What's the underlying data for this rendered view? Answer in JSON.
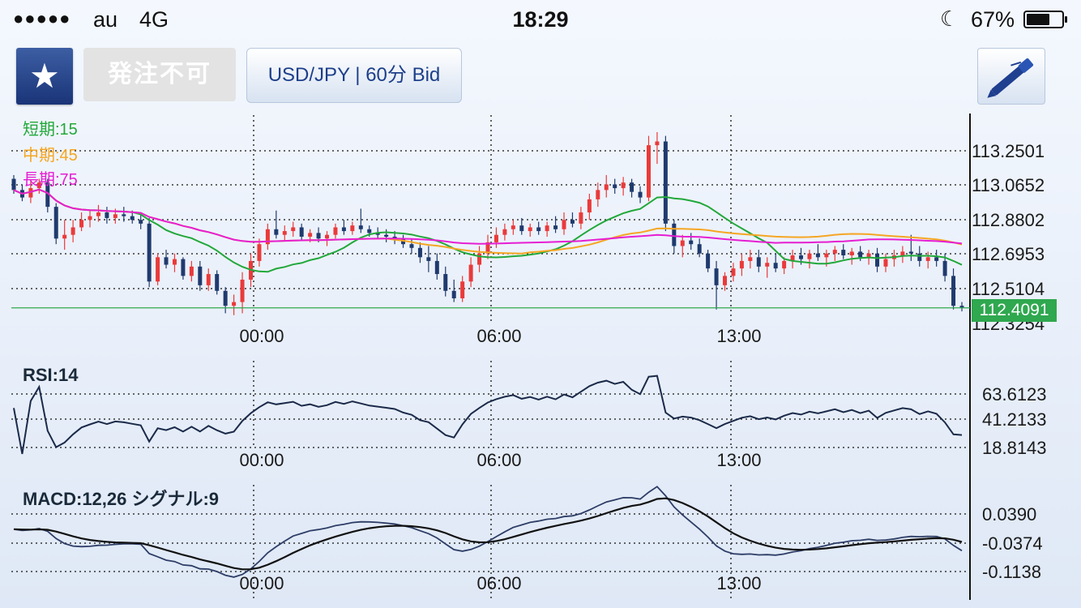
{
  "status_bar": {
    "signal_dots": "●●●●●",
    "carrier": "au",
    "network": "4G",
    "time": "18:29",
    "moon_icon": "☾",
    "battery_percent": "67%",
    "battery_level": 0.67
  },
  "toolbar": {
    "favorite_icon": "★",
    "order_label": "発注不可",
    "symbol_label": "USD/JPY | 60分 Bid",
    "pen_icon": "pen-icon"
  },
  "price_chart": {
    "legend": [
      {
        "label": "短期:15",
        "color": "#22a83a"
      },
      {
        "label": "中期:45",
        "color": "#f5a623"
      },
      {
        "label": "長期:75",
        "color": "#e61ed2"
      }
    ],
    "y_ticks": [
      "113.2501",
      "113.0652",
      "112.8802",
      "112.6953",
      "112.5104",
      "112.3254"
    ],
    "x_ticks": [
      "00:00",
      "06:00",
      "13:00"
    ],
    "current_price": "112.4091",
    "current_price_color": "#2fa84f"
  },
  "rsi_chart": {
    "title": "RSI:14",
    "y_ticks": [
      "63.6123",
      "41.2133",
      "18.8143"
    ],
    "x_ticks": [
      "00:00",
      "06:00",
      "13:00"
    ]
  },
  "macd_chart": {
    "title": "MACD:12,26  シグナル:9",
    "y_ticks": [
      "0.0390",
      "-0.0374",
      "-0.1138"
    ],
    "x_ticks": [
      "00:00",
      "06:00",
      "13:00"
    ]
  },
  "chart_data": [
    {
      "type": "candlestick",
      "title": "USD/JPY | 60分 Bid",
      "y_ticks": [
        113.2501,
        113.0652,
        112.8802,
        112.6953,
        112.5104,
        112.3254
      ],
      "x_ticks": [
        "00:00",
        "06:00",
        "13:00"
      ],
      "series": [
        {
          "name": "短期:15",
          "color": "#22a83a"
        },
        {
          "name": "中期:45",
          "color": "#f5a623"
        },
        {
          "name": "長期:75",
          "color": "#e61ed2"
        }
      ],
      "last": 112.4091,
      "ohlc": [
        [
          113.1,
          113.12,
          113.02,
          113.04
        ],
        [
          113.04,
          113.07,
          112.98,
          113.0
        ],
        [
          113.0,
          113.09,
          112.97,
          113.05
        ],
        [
          113.05,
          113.1,
          113.02,
          113.08
        ],
        [
          113.08,
          113.1,
          112.92,
          112.95
        ],
        [
          112.95,
          112.97,
          112.75,
          112.78
        ],
        [
          112.78,
          112.88,
          112.72,
          112.8
        ],
        [
          112.8,
          112.88,
          112.76,
          112.84
        ],
        [
          112.84,
          112.92,
          112.82,
          112.88
        ],
        [
          112.88,
          112.93,
          112.84,
          112.9
        ],
        [
          112.9,
          112.96,
          112.87,
          112.92
        ],
        [
          112.92,
          112.95,
          112.86,
          112.89
        ],
        [
          112.89,
          112.94,
          112.86,
          112.91
        ],
        [
          112.91,
          112.95,
          112.87,
          112.9
        ],
        [
          112.9,
          112.93,
          112.86,
          112.88
        ],
        [
          112.88,
          112.91,
          112.83,
          112.86
        ],
        [
          112.86,
          112.89,
          112.52,
          112.55
        ],
        [
          112.55,
          112.7,
          112.53,
          112.68
        ],
        [
          112.68,
          112.72,
          112.62,
          112.64
        ],
        [
          112.64,
          112.7,
          112.6,
          112.67
        ],
        [
          112.67,
          112.68,
          112.56,
          112.58
        ],
        [
          112.58,
          112.66,
          112.55,
          112.63
        ],
        [
          112.63,
          112.66,
          112.5,
          112.53
        ],
        [
          112.53,
          112.62,
          112.5,
          112.59
        ],
        [
          112.59,
          112.61,
          112.48,
          112.5
        ],
        [
          112.5,
          112.52,
          112.38,
          112.42
        ],
        [
          112.42,
          112.48,
          112.37,
          112.44
        ],
        [
          112.44,
          112.6,
          112.38,
          112.56
        ],
        [
          112.56,
          112.7,
          112.52,
          112.66
        ],
        [
          112.66,
          112.78,
          112.63,
          112.75
        ],
        [
          112.75,
          112.86,
          112.72,
          112.83
        ],
        [
          112.83,
          112.93,
          112.78,
          112.8
        ],
        [
          112.8,
          112.85,
          112.77,
          112.82
        ],
        [
          112.82,
          112.87,
          112.79,
          112.84
        ],
        [
          112.84,
          112.86,
          112.77,
          112.79
        ],
        [
          112.79,
          112.83,
          112.76,
          112.81
        ],
        [
          112.81,
          112.84,
          112.76,
          112.78
        ],
        [
          112.78,
          112.82,
          112.74,
          112.8
        ],
        [
          112.8,
          112.86,
          112.78,
          112.84
        ],
        [
          112.84,
          112.88,
          112.8,
          112.82
        ],
        [
          112.82,
          112.87,
          112.8,
          112.85
        ],
        [
          112.85,
          112.94,
          112.81,
          112.83
        ],
        [
          112.83,
          112.85,
          112.79,
          112.81
        ],
        [
          112.81,
          112.84,
          112.78,
          112.8
        ],
        [
          112.8,
          112.83,
          112.76,
          112.79
        ],
        [
          112.79,
          112.82,
          112.75,
          112.78
        ],
        [
          112.78,
          112.8,
          112.73,
          112.75
        ],
        [
          112.75,
          112.78,
          112.7,
          112.73
        ],
        [
          112.73,
          112.76,
          112.65,
          112.68
        ],
        [
          112.68,
          112.74,
          112.6,
          112.66
        ],
        [
          112.66,
          112.7,
          112.56,
          112.59
        ],
        [
          112.59,
          112.63,
          112.47,
          112.5
        ],
        [
          112.5,
          112.56,
          112.44,
          112.46
        ],
        [
          112.46,
          112.58,
          112.44,
          112.55
        ],
        [
          112.55,
          112.68,
          112.52,
          112.64
        ],
        [
          112.64,
          112.74,
          112.6,
          112.7
        ],
        [
          112.7,
          112.8,
          112.67,
          112.76
        ],
        [
          112.76,
          112.84,
          112.73,
          112.8
        ],
        [
          112.8,
          112.86,
          112.77,
          112.83
        ],
        [
          112.83,
          112.88,
          112.8,
          112.85
        ],
        [
          112.85,
          112.89,
          112.8,
          112.82
        ],
        [
          112.82,
          112.86,
          112.79,
          112.84
        ],
        [
          112.84,
          112.87,
          112.8,
          112.82
        ],
        [
          112.82,
          112.87,
          112.79,
          112.85
        ],
        [
          112.85,
          112.9,
          112.81,
          112.83
        ],
        [
          112.83,
          112.92,
          112.8,
          112.88
        ],
        [
          112.88,
          112.92,
          112.84,
          112.86
        ],
        [
          112.86,
          112.95,
          112.83,
          112.92
        ],
        [
          112.92,
          113.02,
          112.88,
          112.99
        ],
        [
          112.99,
          113.08,
          112.95,
          113.04
        ],
        [
          113.04,
          113.12,
          113.0,
          113.07
        ],
        [
          113.07,
          113.1,
          113.02,
          113.05
        ],
        [
          113.05,
          113.11,
          113.01,
          113.08
        ],
        [
          113.08,
          113.1,
          113.0,
          113.03
        ],
        [
          113.03,
          113.06,
          112.97,
          113.0
        ],
        [
          113.0,
          113.33,
          112.98,
          113.28
        ],
        [
          113.28,
          113.35,
          113.18,
          113.3
        ],
        [
          113.3,
          113.33,
          112.82,
          112.86
        ],
        [
          112.86,
          112.88,
          112.7,
          112.74
        ],
        [
          112.74,
          112.8,
          112.68,
          112.77
        ],
        [
          112.77,
          112.81,
          112.72,
          112.75
        ],
        [
          112.75,
          112.78,
          112.68,
          112.7
        ],
        [
          112.7,
          112.72,
          112.6,
          112.62
        ],
        [
          112.62,
          112.66,
          112.4,
          112.53
        ],
        [
          112.53,
          112.6,
          112.5,
          112.58
        ],
        [
          112.58,
          112.65,
          112.55,
          112.62
        ],
        [
          112.62,
          112.7,
          112.58,
          112.66
        ],
        [
          112.66,
          112.72,
          112.62,
          112.68
        ],
        [
          112.68,
          112.72,
          112.6,
          112.63
        ],
        [
          112.63,
          112.68,
          112.57,
          112.65
        ],
        [
          112.65,
          112.7,
          112.6,
          112.62
        ],
        [
          112.62,
          112.68,
          112.59,
          112.66
        ],
        [
          112.66,
          112.72,
          112.62,
          112.69
        ],
        [
          112.69,
          112.73,
          112.64,
          112.67
        ],
        [
          112.67,
          112.72,
          112.62,
          112.7
        ],
        [
          112.7,
          112.75,
          112.66,
          112.68
        ],
        [
          112.68,
          112.72,
          112.63,
          112.7
        ],
        [
          112.7,
          112.74,
          112.66,
          112.72
        ],
        [
          112.72,
          112.75,
          112.67,
          112.69
        ],
        [
          112.69,
          112.73,
          112.64,
          112.71
        ],
        [
          112.71,
          112.74,
          112.66,
          112.68
        ],
        [
          112.68,
          112.72,
          112.64,
          112.7
        ],
        [
          112.7,
          112.73,
          112.6,
          112.63
        ],
        [
          112.63,
          112.7,
          112.6,
          112.67
        ],
        [
          112.67,
          112.72,
          112.63,
          112.69
        ],
        [
          112.69,
          112.74,
          112.65,
          112.71
        ],
        [
          112.71,
          112.8,
          112.66,
          112.7
        ],
        [
          112.7,
          112.74,
          112.63,
          112.66
        ],
        [
          112.66,
          112.71,
          112.62,
          112.68
        ],
        [
          112.68,
          112.72,
          112.63,
          112.66
        ],
        [
          112.66,
          112.7,
          112.55,
          112.58
        ],
        [
          112.58,
          112.62,
          112.4,
          112.42
        ],
        [
          112.42,
          112.44,
          112.39,
          112.41
        ]
      ]
    },
    {
      "type": "line",
      "title": "RSI:14",
      "y_ticks": [
        63.6123,
        41.2133,
        18.8143
      ],
      "x_ticks": [
        "00:00",
        "06:00",
        "13:00"
      ],
      "series": [
        {
          "name": "RSI:14",
          "color": "#1b2a49"
        }
      ]
    },
    {
      "type": "line",
      "title": "MACD:12,26  シグナル:9",
      "y_ticks": [
        0.039,
        -0.0374,
        -0.1138
      ],
      "x_ticks": [
        "00:00",
        "06:00",
        "13:00"
      ],
      "series": [
        {
          "name": "MACD:12,26",
          "color": "#2d3d66"
        },
        {
          "name": "シグナル:9",
          "color": "#111111"
        }
      ]
    }
  ]
}
